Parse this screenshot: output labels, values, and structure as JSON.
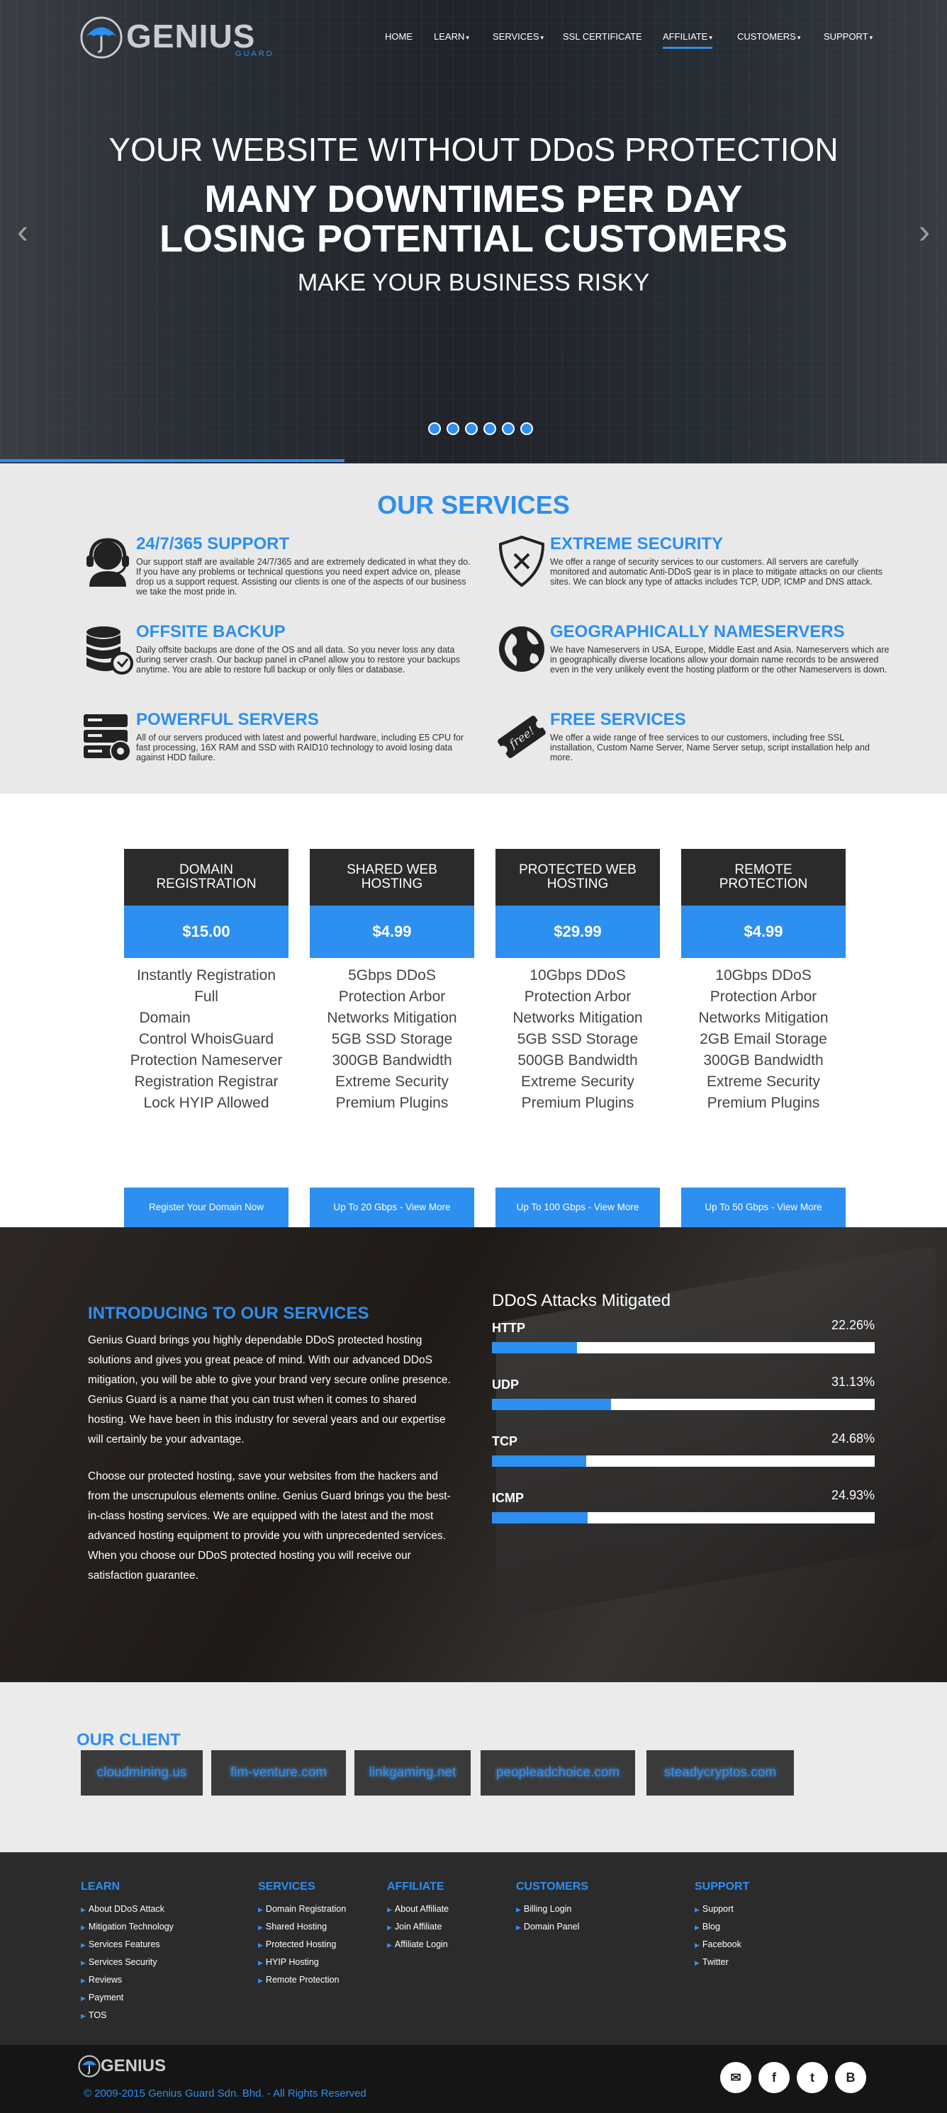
{
  "brand": {
    "name": "GENIUS",
    "sub": "GUARD",
    "accent": "#2d8ff0"
  },
  "nav": {
    "items": [
      {
        "label": "HOME",
        "caret": ""
      },
      {
        "label": "LEARN",
        "caret": "▾"
      },
      {
        "label": "SERVICES",
        "caret": "▾"
      },
      {
        "label": "SSL CERTIFICATE",
        "caret": ""
      },
      {
        "label": "AFFILIATE",
        "caret": "▾"
      },
      {
        "label": "CUSTOMERS",
        "caret": "▾"
      },
      {
        "label": "SUPPORT",
        "caret": "▾"
      }
    ]
  },
  "hero": {
    "line1": "YOUR WEBSITE WITHOUT DDoS PROTECTION",
    "line2": "MANY DOWNTIMES PER DAY",
    "line3": "LOSING POTENTIAL CUSTOMERS",
    "line4": "MAKE YOUR BUSINESS RISKY",
    "prev": "‹",
    "next": "›",
    "slide_count": 6
  },
  "services": {
    "title": "OUR SERVICES",
    "items": [
      {
        "icon": "support-agent-icon",
        "title": "24/7/365 SUPPORT",
        "text": "Our support staff are available 24/7/365 and are extremely dedicated in what they do. If you have any problems or technical questions you need expert advice on, please drop us a support request. Assisting our clients is one of the aspects of our business we take the most pride in."
      },
      {
        "icon": "shield-icon",
        "title": "EXTREME SECURITY",
        "text": "We offer a range of security services to our customers. All servers are carefully monitored and automatic Anti-DDoS gear is in place to mitigate attacks on our clients sites. We can block any type of attacks includes TCP, UDP, ICMP and DNS attack."
      },
      {
        "icon": "database-backup-icon",
        "title": "OFFSITE BACKUP",
        "text": "Daily offsite backups are done of the OS and all data. So you never loss any data during server crash. Our backup panel in cPanel allow you to restore your backups anytime. You are able to restore full backup or only files or database."
      },
      {
        "icon": "globe-icon",
        "title": "GEOGRAPHICALLY NAMESERVERS",
        "text": "We have Nameservers in USA, Europe, Middle East and Asia. Nameservers which are in geographically diverse locations allow your domain name records to be answered even in the very unlikely event the hosting platform or the other Nameservers is down."
      },
      {
        "icon": "server-gear-icon",
        "title": "POWERFUL SERVERS",
        "text": "All of our servers produced with latest and powerful hardware, including E5 CPU for fast processing, 16X RAM and SSD with RAID10 technology to avoid losing data against HDD failure."
      },
      {
        "icon": "free-ticket-icon",
        "title": "FREE SERVICES",
        "text": "We offer a wide range of free services to our customers, including free SSL installation, Custom Name Server, Name Server setup, script installation help and more."
      }
    ]
  },
  "pricing": {
    "plans": [
      {
        "name": "DOMAIN REGISTRATION",
        "price": "$15.00",
        "features": "Instantly Registration Full Domain                     Control WhoisGuard Protection Nameserver Registration Registrar Lock HYIP Allowed",
        "button": "Register Your Domain Now"
      },
      {
        "name": "SHARED WEB HOSTING",
        "price": "$4.99",
        "features": "5Gbps DDoS Protection Arbor Networks Mitigation 5GB SSD Storage 300GB Bandwidth Extreme Security Premium Plugins",
        "button": "Up To 20 Gbps - View More"
      },
      {
        "name": "PROTECTED WEB HOSTING",
        "price": "$29.99",
        "features": "10Gbps DDoS Protection Arbor Networks Mitigation 5GB SSD Storage 500GB Bandwidth Extreme Security Premium Plugins",
        "button": "Up To 100 Gbps - View More"
      },
      {
        "name": "REMOTE PROTECTION",
        "price": "$4.99",
        "features": "10Gbps DDoS Protection Arbor Networks Mitigation 2GB Email Storage 300GB Bandwidth Extreme Security Premium Plugins",
        "button": "Up To 50 Gbps - View More"
      }
    ]
  },
  "intro": {
    "title": "INTRODUCING TO OUR SERVICES",
    "para1": "Genius Guard brings you highly dependable DDoS protected hosting solutions and gives you great peace of mind. With our advanced DDoS mitigation, you will be able to give your brand very secure online presence. Genius Guard is a name that you can trust when it comes to shared hosting. We have been in this industry for several years and our expertise will certainly be your advantage.",
    "para2": "Choose our protected hosting, save your websites from the hackers and from the unscrupulous elements online. Genius Guard brings you the best-in-class hosting services. We are equipped with the latest and the most advanced hosting equipment to provide you with unprecedented services. When you choose our DDoS protected hosting you will receive our satisfaction guarantee."
  },
  "chart_data": {
    "type": "bar",
    "title": "DDoS Attacks Mitigated",
    "categories": [
      "HTTP",
      "UDP",
      "TCP",
      "ICMP"
    ],
    "values": [
      22.26,
      31.13,
      24.68,
      24.93
    ],
    "labels": [
      "22.26%",
      "31.13%",
      "24.68%",
      "24.93%"
    ],
    "ylim": [
      0,
      100
    ]
  },
  "clients": {
    "title": "OUR CLIENT",
    "items": [
      "cloudmining.us",
      "fim-venture.com",
      "linkgaming.net",
      "peopleadchoice.com",
      "steadycryptos.com"
    ]
  },
  "footer": {
    "columns": [
      {
        "title": "LEARN",
        "links": [
          "About DDoS Attack",
          "Mitigation Technology",
          "Services Features",
          "Services Security",
          "Reviews",
          "Payment",
          "TOS"
        ]
      },
      {
        "title": "SERVICES",
        "links": [
          "Domain Registration",
          "Shared Hosting",
          "Protected Hosting",
          "HYIP Hosting",
          "Remote Protection"
        ]
      },
      {
        "title": "AFFILIATE",
        "links": [
          "About Affiliate",
          "Join Affiliate",
          "Affiliate Login"
        ]
      },
      {
        "title": "CUSTOMERS",
        "links": [
          "Billing Login",
          "Domain Panel"
        ]
      },
      {
        "title": "SUPPORT",
        "links": [
          "Support",
          "Blog",
          "Facebook",
          "Twitter"
        ]
      }
    ],
    "copyright": "© 2009-2015 Genius Guard Sdn. Bhd. - All Rights Reserved",
    "social": [
      {
        "icon": "email-icon",
        "glyph": "✉"
      },
      {
        "icon": "facebook-icon",
        "glyph": "f"
      },
      {
        "icon": "twitter-icon",
        "glyph": "t"
      },
      {
        "icon": "blog-icon",
        "glyph": "B"
      }
    ]
  }
}
